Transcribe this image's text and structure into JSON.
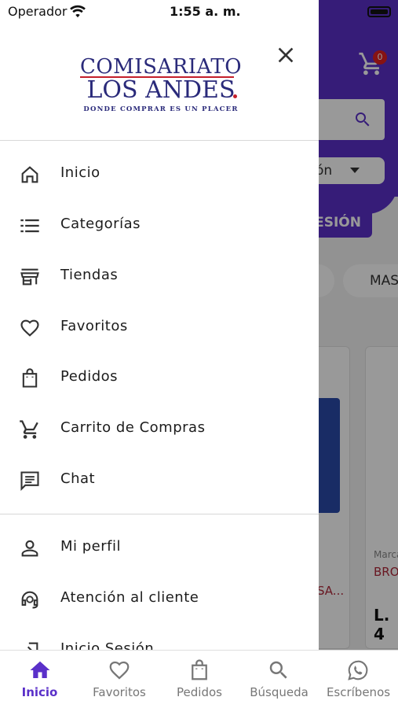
{
  "status_bar": {
    "carrier": "Operador",
    "time": "1:55 a. m."
  },
  "logo": {
    "line1": "COMISARIATO",
    "line2": "LOS ANDES",
    "tagline": "DONDE COMPRAR ES UN PLACER"
  },
  "background": {
    "cart_count": "0",
    "dropdown_text": "ón",
    "login_text": "ESIÓN",
    "chip_text": "MAS",
    "card_brand": "Marca",
    "card_name_a": "SA...",
    "card_name_b": "BRO",
    "card_price": "L. 4",
    "colors": {
      "primary": "#5a30c9",
      "badge": "#e02020",
      "accent_red": "#b0283a"
    }
  },
  "drawer": {
    "menu_primary": [
      {
        "label": "Inicio",
        "icon": "home-icon"
      },
      {
        "label": "Categorías",
        "icon": "list-icon"
      },
      {
        "label": "Tiendas",
        "icon": "store-icon"
      },
      {
        "label": "Favoritos",
        "icon": "heart-icon"
      },
      {
        "label": "Pedidos",
        "icon": "shopping-bag-icon"
      },
      {
        "label": "Carrito de Compras",
        "icon": "cart-icon"
      },
      {
        "label": "Chat",
        "icon": "chat-icon"
      }
    ],
    "menu_secondary": [
      {
        "label": "Mi perfil",
        "icon": "person-icon"
      },
      {
        "label": "Atención al cliente",
        "icon": "support-agent-icon"
      },
      {
        "label": "Inicio Sesión",
        "icon": "login-icon"
      }
    ]
  },
  "tabbar": {
    "tabs": [
      {
        "label": "Inicio",
        "icon": "home-icon",
        "active": true
      },
      {
        "label": "Favoritos",
        "icon": "heart-icon",
        "active": false
      },
      {
        "label": "Pedidos",
        "icon": "shopping-bag-icon",
        "active": false
      },
      {
        "label": "Búsqueda",
        "icon": "search-icon",
        "active": false
      },
      {
        "label": "Escríbenos",
        "icon": "whatsapp-icon",
        "active": false
      }
    ],
    "active_color": "#5a30c9"
  }
}
